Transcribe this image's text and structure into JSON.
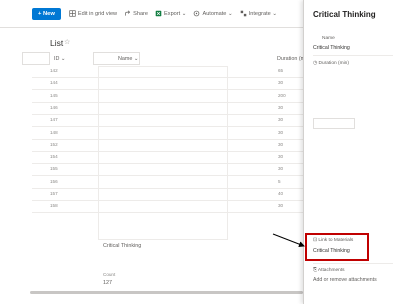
{
  "toolbar": {
    "new_label": "New",
    "edit_grid_label": "Edit in grid view",
    "share_label": "Share",
    "export_label": "Export",
    "automate_label": "Automate",
    "integrate_label": "Integrate"
  },
  "list": {
    "title": "List",
    "columns": {
      "id": "ID",
      "name": "Name",
      "duration": "Duration (min"
    },
    "rows": [
      {
        "id": "142",
        "duration": "65"
      },
      {
        "id": "144",
        "duration": "30"
      },
      {
        "id": "145",
        "duration": "200"
      },
      {
        "id": "146",
        "duration": "30"
      },
      {
        "id": "147",
        "duration": "30"
      },
      {
        "id": "148",
        "duration": "30"
      },
      {
        "id": "152",
        "duration": "30"
      },
      {
        "id": "154",
        "duration": "30"
      },
      {
        "id": "155",
        "duration": "30"
      },
      {
        "id": "156",
        "duration": "5"
      },
      {
        "id": "157",
        "duration": "40",
        "name": "Critical Thinking"
      },
      {
        "id": "158",
        "duration": "30"
      }
    ],
    "count_label": "Count",
    "count_value": "127"
  },
  "panel": {
    "title": "Critical Thinking",
    "name_label": "Name",
    "name_value": "Critical Thinking",
    "duration_label": "Duration (min)",
    "link_label": "Link to Materials",
    "link_value": "Critical Thinking",
    "attachments_label": "Attachments",
    "attachments_action": "Add or remove attachments"
  },
  "colors": {
    "accent": "#0078d4",
    "highlight": "#c00000"
  }
}
